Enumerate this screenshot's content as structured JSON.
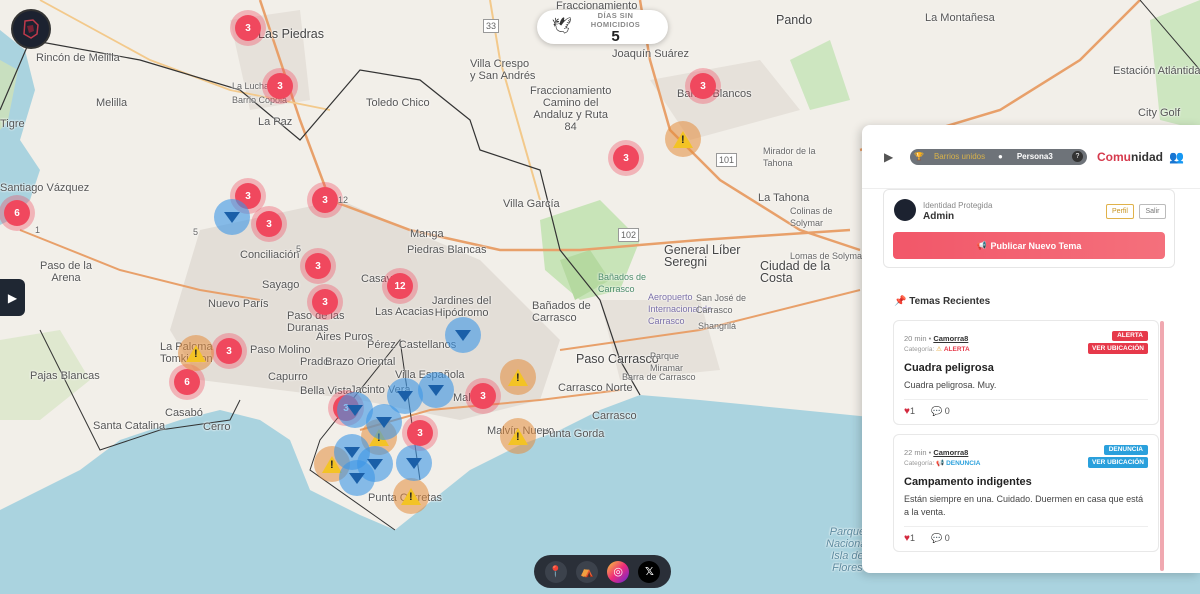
{
  "map": {
    "places": [
      {
        "name": "Las Piedras",
        "cls": "big"
      },
      {
        "name": "Rincón de Melilla",
        "cls": ""
      },
      {
        "name": "Melilla",
        "cls": ""
      },
      {
        "name": "Villa Crespo\ny San Andrés",
        "cls": ""
      },
      {
        "name": "Joaquín Suárez",
        "cls": ""
      },
      {
        "name": "Fraccionamiento\nCamino del\nAndaluz y Ruta\n84",
        "cls": ""
      },
      {
        "name": "La Lucha",
        "cls": "tiny"
      },
      {
        "name": "Barrio Copola",
        "cls": "tiny"
      },
      {
        "name": "La Paz",
        "cls": ""
      },
      {
        "name": "Toledo Chico",
        "cls": ""
      },
      {
        "name": "Pando",
        "cls": "big"
      },
      {
        "name": "La Montañesa",
        "cls": ""
      },
      {
        "name": "Estación Atlántida",
        "cls": ""
      },
      {
        "name": "Barros Blancos",
        "cls": ""
      },
      {
        "name": "City Golf",
        "cls": ""
      },
      {
        "name": "Mirador de la\nTahona",
        "cls": "tiny"
      },
      {
        "name": "La Tahona",
        "cls": ""
      },
      {
        "name": "Colinas de\nSolymar",
        "cls": "tiny"
      },
      {
        "name": "Lomas de Solymar",
        "cls": "tiny"
      },
      {
        "name": "General Líber\nSeregni",
        "cls": "big"
      },
      {
        "name": "Ciudad de la\nCosta",
        "cls": "big"
      },
      {
        "name": "Villa García",
        "cls": ""
      },
      {
        "name": "Manga",
        "cls": ""
      },
      {
        "name": "Piedras Blancas",
        "cls": ""
      },
      {
        "name": "Conciliación",
        "cls": ""
      },
      {
        "name": "Sayago",
        "cls": ""
      },
      {
        "name": "Casavalle",
        "cls": ""
      },
      {
        "name": "Jardines del\nHipódromo",
        "cls": ""
      },
      {
        "name": "Bañados de\nCarrasco",
        "cls": ""
      },
      {
        "name": "Bañados de\nCarrasco",
        "cls": "tiny"
      },
      {
        "name": "Aeropuerto\nInternacional de\nCarrasco",
        "cls": "tiny"
      },
      {
        "name": "San José de\nCarrasco",
        "cls": "tiny"
      },
      {
        "name": "Shangrilá",
        "cls": "tiny"
      },
      {
        "name": "Paso de la\nArena",
        "cls": ""
      },
      {
        "name": "Nuevo París",
        "cls": ""
      },
      {
        "name": "Paso de las\nDuranas",
        "cls": ""
      },
      {
        "name": "Las Acacias",
        "cls": ""
      },
      {
        "name": "Aires Puros",
        "cls": ""
      },
      {
        "name": "Pérez Castellanos",
        "cls": ""
      },
      {
        "name": "Paso Molino",
        "cls": ""
      },
      {
        "name": "Prado",
        "cls": ""
      },
      {
        "name": "Brazo Oriental",
        "cls": ""
      },
      {
        "name": "Paso Carrasco",
        "cls": "big"
      },
      {
        "name": "Parque\nMiramar",
        "cls": "tiny"
      },
      {
        "name": "Barra de Carrasco",
        "cls": "tiny"
      },
      {
        "name": "La Paloma\nTomkinson",
        "cls": ""
      },
      {
        "name": "Pajas Blancas",
        "cls": ""
      },
      {
        "name": "Capurro",
        "cls": ""
      },
      {
        "name": "Villa Española",
        "cls": ""
      },
      {
        "name": "Bella Vista",
        "cls": ""
      },
      {
        "name": "Jacinto Vera",
        "cls": ""
      },
      {
        "name": "Carrasco Norte",
        "cls": ""
      },
      {
        "name": "Malvín",
        "cls": ""
      },
      {
        "name": "Carrasco",
        "cls": ""
      },
      {
        "name": "Casabó",
        "cls": ""
      },
      {
        "name": "Santa Catalina",
        "cls": ""
      },
      {
        "name": "Cerro",
        "cls": ""
      },
      {
        "name": "Malvín Nuevo",
        "cls": ""
      },
      {
        "name": "Punta Gorda",
        "cls": ""
      },
      {
        "name": "Punta Carretas",
        "cls": ""
      },
      {
        "name": "Parque\nNacional\nIsla de\nFlores",
        "cls": "water"
      },
      {
        "name": "Tigre",
        "cls": ""
      },
      {
        "name": "Santiago Vázquez",
        "cls": ""
      },
      {
        "name": "Fraccionamiento",
        "cls": ""
      },
      {
        "name": "Tomkinson",
        "cls": "tiny"
      }
    ],
    "clusters": [
      "3",
      "3",
      "3",
      "3",
      "3",
      "3",
      "3",
      "6",
      "3",
      "3",
      "3",
      "12",
      "3",
      "6",
      "3",
      "3"
    ],
    "warnings": [
      "warning",
      "warning",
      "warning",
      "warning",
      "warning",
      "warning",
      "warning"
    ],
    "tents": [
      "tent",
      "tent",
      "tent",
      "tent",
      "tent",
      "tent",
      "tent",
      "tent",
      "tent",
      "tent"
    ],
    "road_labels": [
      "33",
      "101",
      "102",
      "1",
      "5",
      "5",
      "12"
    ]
  },
  "homicide_counter": {
    "label": "DÍAS SIN HOMICIDIOS",
    "value": "5"
  },
  "panel": {
    "audio": {
      "track_left": "Barrios unidos",
      "track_right": "Persona3",
      "help": "?"
    },
    "title_a": "Comu",
    "title_b": "nidad",
    "user": {
      "subtitle": "Identidad Protegida",
      "name": "Admin",
      "perfil": "Perfil",
      "salir": "Salir"
    },
    "publish_label": "Publicar Nuevo Tema",
    "recent_title": "Temas Recientes",
    "posts": [
      {
        "time": "20 min",
        "author": "Camorra8",
        "category_prefix": "Categoría:",
        "category": "ALERTA",
        "badge": "ALERTA",
        "badge_color": "#e6394a",
        "loc_label": "VER UBICACIÓN",
        "title": "Cuadra peligrosa",
        "body": "Cuadra peligrosa. Muy.",
        "likes": "1",
        "comments": "0"
      },
      {
        "time": "22 min",
        "author": "Camorra8",
        "category_prefix": "Categoría:",
        "category": "DENUNCIA",
        "badge": "DENUNCIA",
        "badge_color": "#2aa0dc",
        "loc_label": "VER UBICACIÓN",
        "title": "Campamento indigentes",
        "body": "Están siempre en una. Cuidado. Duermen en casa que está a la venta.",
        "likes": "1",
        "comments": "0"
      }
    ]
  },
  "colors": {
    "cluster": "#f0485e",
    "warning": "#e48c3c",
    "tent": "#3c96e6",
    "publish": "#f25769",
    "alerta": "#e6394a",
    "denuncia": "#2aa0dc"
  }
}
